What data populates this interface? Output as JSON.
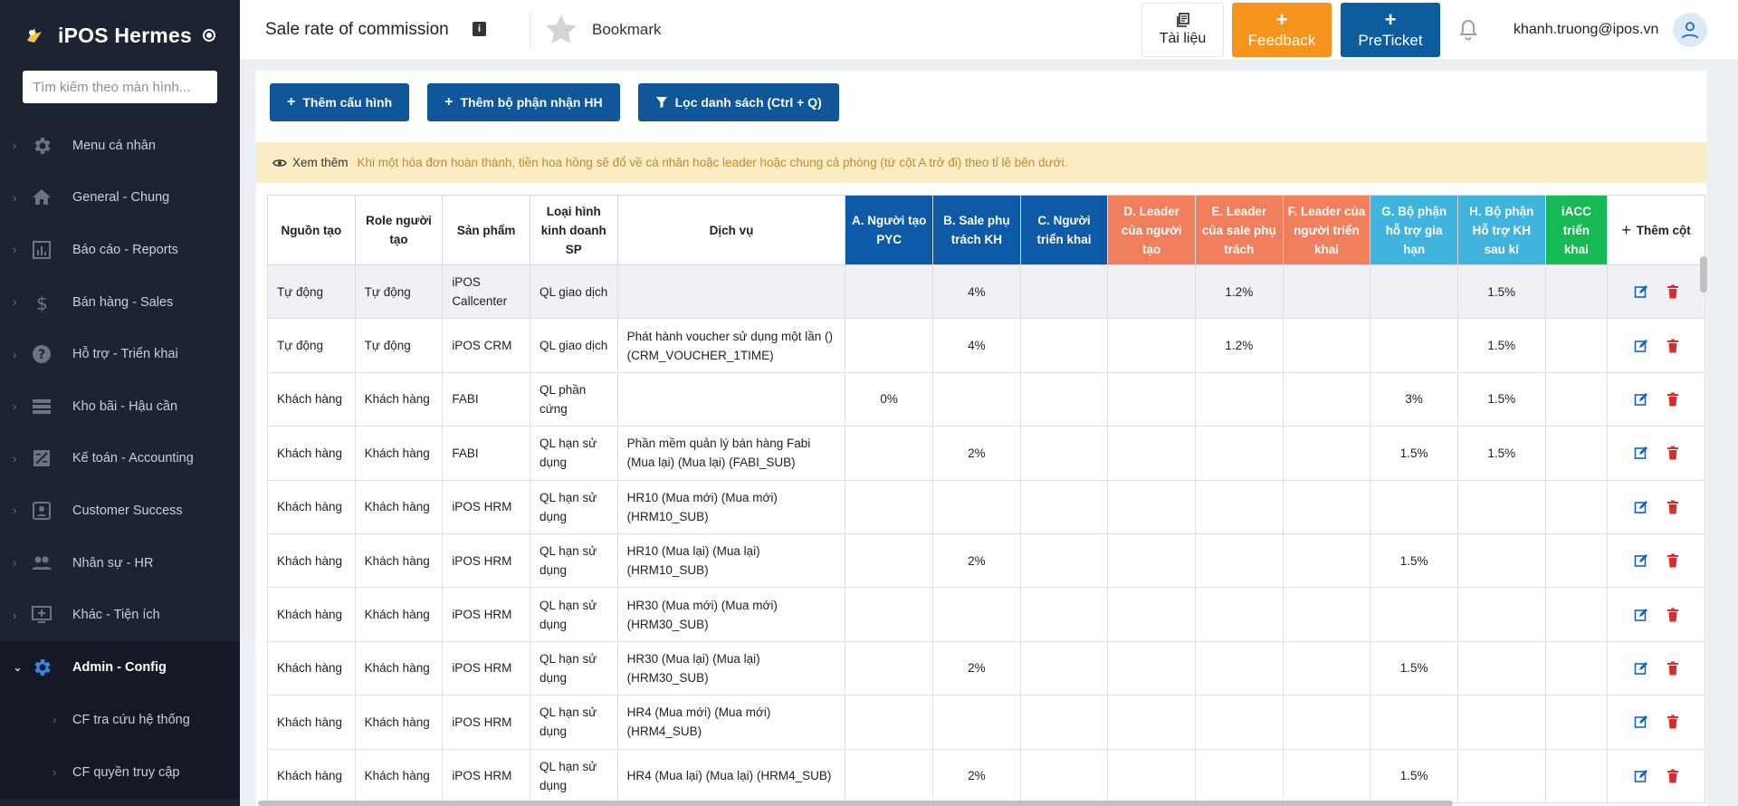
{
  "sidebar": {
    "brand": "iPOS Hermes",
    "search_placeholder": "Tìm kiếm theo màn hình...",
    "items": [
      {
        "label": "Menu cá nhân",
        "icon": "gear-icon"
      },
      {
        "label": "General - Chung",
        "icon": "home-icon"
      },
      {
        "label": "Báo cáo - Reports",
        "icon": "bar-chart-icon"
      },
      {
        "label": "Bán hàng - Sales",
        "icon": "dollar-icon"
      },
      {
        "label": "Hỗ trợ - Triển khai",
        "icon": "help-icon"
      },
      {
        "label": "Kho bãi - Hậu cần",
        "icon": "warehouse-icon"
      },
      {
        "label": "Kế toán - Accounting",
        "icon": "accounting-icon"
      },
      {
        "label": "Customer Success",
        "icon": "customer-icon"
      },
      {
        "label": "Nhân sự - HR",
        "icon": "people-icon"
      },
      {
        "label": "Khác - Tiện ích",
        "icon": "monitor-plus-icon"
      },
      {
        "label": "Admin - Config",
        "icon": "gear-icon"
      }
    ],
    "sub_items": [
      {
        "label": "CF tra cứu hệ thống"
      },
      {
        "label": "CF quyền truy cập"
      }
    ]
  },
  "header": {
    "title": "Sale rate of commission",
    "bookmark_label": "Bookmark",
    "docs_label": "Tài liệu",
    "feedback_label": "Feedback",
    "preticket_label": "PreTicket",
    "user_email": "khanh.truong@ipos.vn"
  },
  "toolbar": {
    "add_config": "Thêm cấu hình",
    "add_dept": "Thêm bộ phận nhận HH",
    "filter": "Lọc danh sách (Ctrl + Q)"
  },
  "notice": {
    "see_more": "Xem thêm",
    "message": "Khi một hóa đơn hoàn thành, tiền hoa hồng sẽ đổ về cá nhân hoặc leader hoặc chung cả phòng (từ cột A trở đi) theo tỉ lệ bên dưới."
  },
  "table": {
    "headers": [
      "Nguồn tạo",
      "Role người tạo",
      "Sản phẩm",
      "Loại hình kinh doanh SP",
      "Dịch vụ",
      "A. Người tạo PYC",
      "B. Sale phụ trách KH",
      "C. Người triển khai",
      "D. Leader của người tạo",
      "E. Leader của sale phụ trách",
      "F. Leader của người triển khai",
      "G. Bộ phận hỗ trợ gia hạn",
      "H. Bộ phận Hỗ trợ KH sau kí",
      "iACC triển khai",
      "Thêm cột"
    ],
    "rows": [
      {
        "c": [
          "Tự động",
          "Tự động",
          "iPOS Callcenter",
          "QL giao dịch",
          "",
          "",
          "4%",
          "",
          "",
          "1.2%",
          "",
          "",
          "1.5%",
          ""
        ]
      },
      {
        "c": [
          "Tự động",
          "Tự động",
          "iPOS CRM",
          "QL giao dịch",
          "Phát hành voucher sử dụng một lần () (CRM_VOUCHER_1TIME)",
          "",
          "4%",
          "",
          "",
          "1.2%",
          "",
          "",
          "1.5%",
          ""
        ]
      },
      {
        "c": [
          "Khách hàng",
          "Khách hàng",
          "FABI",
          "QL phần cứng",
          "",
          "0%",
          "",
          "",
          "",
          "",
          "",
          "3%",
          "1.5%",
          ""
        ]
      },
      {
        "c": [
          "Khách hàng",
          "Khách hàng",
          "FABI",
          "QL hạn sử dụng",
          "Phần mềm quản lý bán hàng Fabi (Mua lại) (Mua lại) (FABI_SUB)",
          "",
          "2%",
          "",
          "",
          "",
          "",
          "1.5%",
          "1.5%",
          ""
        ]
      },
      {
        "c": [
          "Khách hàng",
          "Khách hàng",
          "iPOS HRM",
          "QL hạn sử dụng",
          "HR10 (Mua mới) (Mua mới) (HRM10_SUB)",
          "",
          "",
          "",
          "",
          "",
          "",
          "",
          "",
          ""
        ]
      },
      {
        "c": [
          "Khách hàng",
          "Khách hàng",
          "iPOS HRM",
          "QL hạn sử dụng",
          "HR10 (Mua lại) (Mua lại) (HRM10_SUB)",
          "",
          "2%",
          "",
          "",
          "",
          "",
          "1.5%",
          "",
          ""
        ]
      },
      {
        "c": [
          "Khách hàng",
          "Khách hàng",
          "iPOS HRM",
          "QL hạn sử dụng",
          "HR30 (Mua mới) (Mua mới) (HRM30_SUB)",
          "",
          "",
          "",
          "",
          "",
          "",
          "",
          "",
          ""
        ]
      },
      {
        "c": [
          "Khách hàng",
          "Khách hàng",
          "iPOS HRM",
          "QL hạn sử dụng",
          "HR30 (Mua lại) (Mua lại) (HRM30_SUB)",
          "",
          "2%",
          "",
          "",
          "",
          "",
          "1.5%",
          "",
          ""
        ]
      },
      {
        "c": [
          "Khách hàng",
          "Khách hàng",
          "iPOS HRM",
          "QL hạn sử dụng",
          "HR4 (Mua mới) (Mua mới) (HRM4_SUB)",
          "",
          "",
          "",
          "",
          "",
          "",
          "",
          "",
          ""
        ]
      },
      {
        "c": [
          "Khách hàng",
          "Khách hàng",
          "iPOS HRM",
          "QL hạn sử dụng",
          "HR4 (Mua lại) (Mua lại) (HRM4_SUB)",
          "",
          "2%",
          "",
          "",
          "",
          "",
          "1.5%",
          "",
          ""
        ]
      }
    ]
  },
  "colors": {
    "sidebar_bg": "#1d2330",
    "primary": "#10579a",
    "feedback": "#f7941d",
    "preticket": "#0d5c9e",
    "header_blue": "#0e5aa6",
    "header_orange": "#ef7f5d",
    "header_cyan": "#40b4dd",
    "header_green": "#17b954",
    "edit_icon": "#1565c0",
    "delete_icon": "#d32f2f",
    "notice_bg": "#fcecc4"
  }
}
